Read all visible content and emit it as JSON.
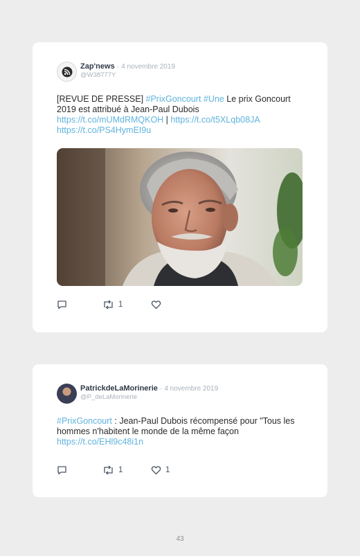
{
  "tweets": [
    {
      "author": "Zap'news",
      "separator": "·",
      "date": "4 novembre 2019",
      "handle": "@W38777Y",
      "text": {
        "prefix": "[REVUE DE PRESSE] ",
        "hashtag1": "#PrixGoncourt",
        "hashtag2": "#Une",
        "body": " Le prix Goncourt 2019 est attribué à Jean-Paul Dubois ",
        "link1": "https://t.co/mUMdRMQKOH",
        "pipe": " | ",
        "link2": "https://t.co/t5XLqb08JA",
        "link3": "https://t.co/PS4HymEI9u"
      },
      "avatar_icon": "rss-icon",
      "retweets": "1",
      "likes": ""
    },
    {
      "author": "PatrickdeLaMorinerie",
      "separator": "·",
      "date": "4 novembre 2019",
      "handle": "@P_deLaMorinerie",
      "text": {
        "hashtag1": "#PrixGoncourt",
        "body": " : Jean-Paul Dubois récompensé pour \"Tous les hommes n'habitent le monde de la même façon",
        "link1": "https://t.co/EHl9c48i1n"
      },
      "retweets": "1",
      "likes": "1"
    }
  ],
  "page_number": "43",
  "colors": {
    "background": "#ededed",
    "card": "#ffffff",
    "link": "#5fb3de",
    "muted": "#a9b1bb",
    "author": "#2f3a4a"
  }
}
